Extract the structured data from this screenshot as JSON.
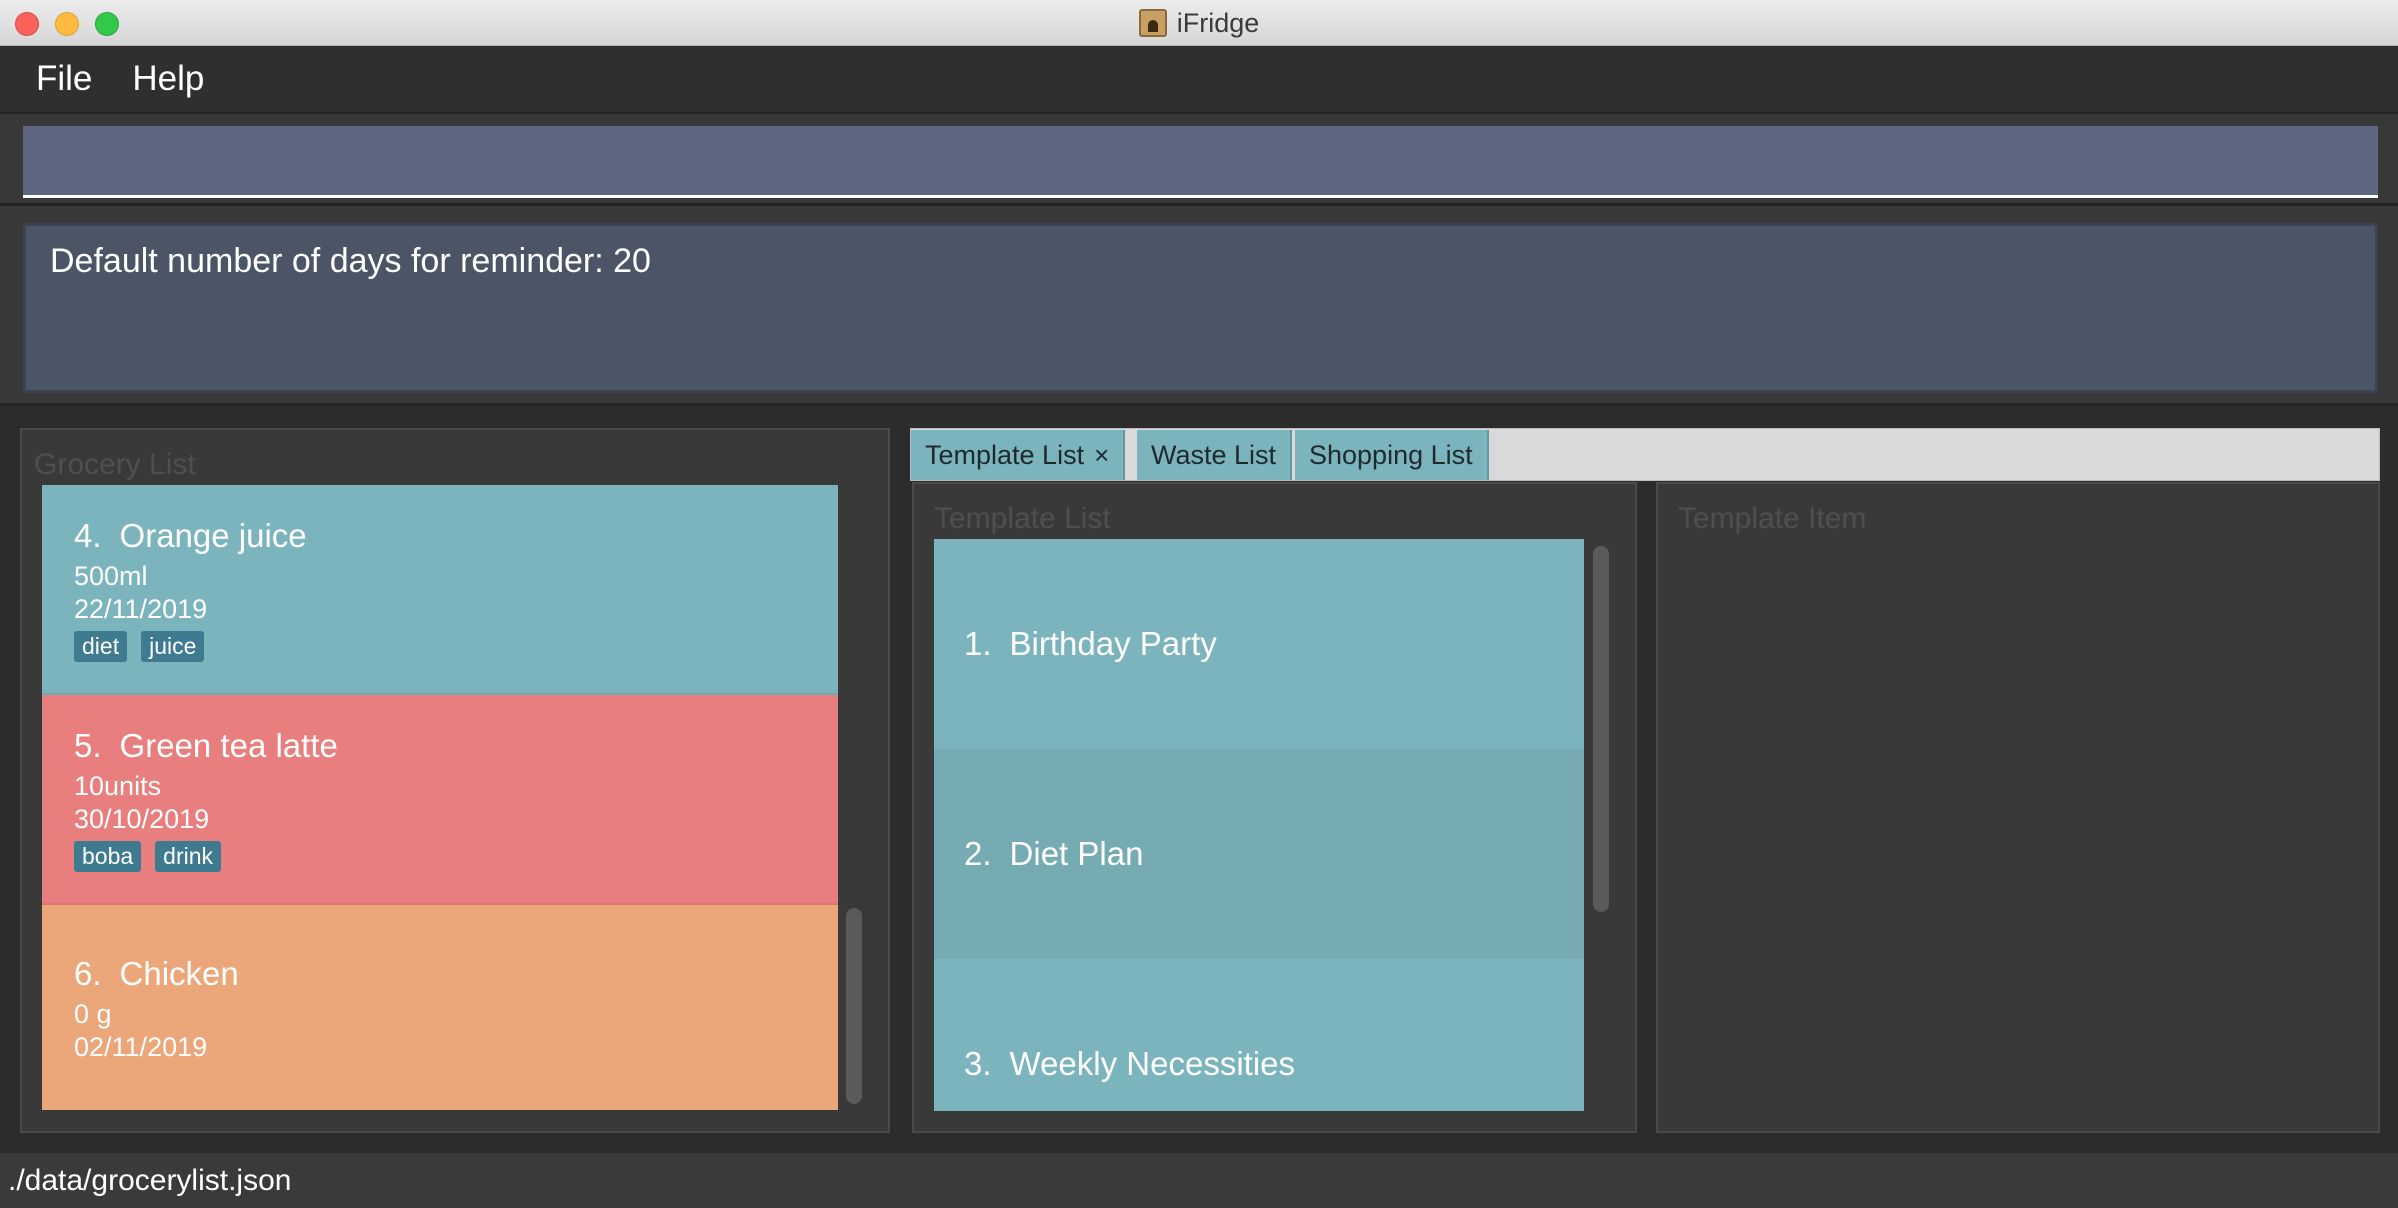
{
  "window": {
    "title": "iFridge"
  },
  "menu": {
    "items": [
      "File",
      "Help"
    ]
  },
  "command_box": {
    "value": "",
    "placeholder": ""
  },
  "result": {
    "text": "Default number of days for reminder: 20"
  },
  "grocery": {
    "title": "Grocery List",
    "items": [
      {
        "index": "4.",
        "name": "Orange juice",
        "amount": "500ml",
        "date": "22/11/2019",
        "tags": [
          "diet",
          "juice"
        ],
        "color": "#7cb4bd"
      },
      {
        "index": "5.",
        "name": "Green tea latte",
        "amount": "10units",
        "date": "30/10/2019",
        "tags": [
          "boba",
          "drink"
        ],
        "color": "#e87e7e"
      },
      {
        "index": "6.",
        "name": "Chicken",
        "amount": "0 g",
        "date": "02/11/2019",
        "tags": [],
        "color": "#eba679"
      }
    ]
  },
  "tabs": [
    {
      "label": "Template List",
      "close": "×",
      "selected": true
    },
    {
      "label": "Waste List"
    },
    {
      "label": "Shopping List"
    }
  ],
  "template_list": {
    "title": "Template List",
    "items": [
      {
        "index": "1.",
        "name": "Birthday Party"
      },
      {
        "index": "2.",
        "name": "Diet Plan"
      },
      {
        "index": "3.",
        "name": "Weekly Necessities"
      }
    ]
  },
  "template_item": {
    "title": "Template Item"
  },
  "status": {
    "path": "./data/grocerylist.json"
  },
  "colors": {
    "accent": "#7cb4bd",
    "expired": "#e87e7e",
    "expiring": "#eba679",
    "tag": "#3e7b91"
  }
}
